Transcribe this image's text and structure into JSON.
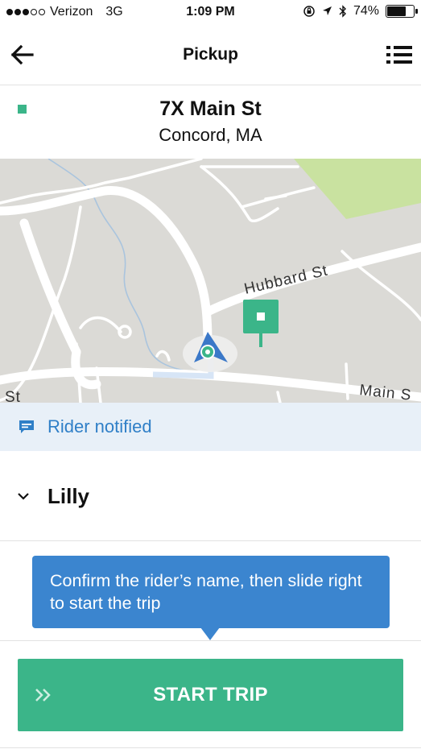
{
  "status_bar": {
    "carrier": "Verizon",
    "network": "3G",
    "time": "1:09 PM",
    "battery_percent": "74%",
    "battery_level": 0.74,
    "signal_bars": 3
  },
  "nav": {
    "title": "Pickup",
    "back_icon": "arrow-left-icon",
    "list_icon": "list-icon"
  },
  "address": {
    "line1": "7X Main St",
    "line2": "Concord, MA"
  },
  "map": {
    "street_hubbard": "Hubbard St",
    "street_main": "Main S",
    "street_left": "St"
  },
  "notification": {
    "text": "Rider notified",
    "icon": "chat-bubble-icon"
  },
  "rider": {
    "name": "Lilly",
    "expand_icon": "chevron-down-icon"
  },
  "tooltip": {
    "text": "Confirm the rider’s name, then slide right to start the trip"
  },
  "start_trip": {
    "label": "START TRIP",
    "handle_icon": "double-chevron-right-icon"
  },
  "colors": {
    "accent_green": "#3bb589",
    "tooltip_blue": "#3b85cf",
    "notified_text": "#2f7fc7",
    "notified_bg": "#e8f0f8",
    "map_land": "#dbdad6",
    "map_park": "#c9e2a0"
  }
}
